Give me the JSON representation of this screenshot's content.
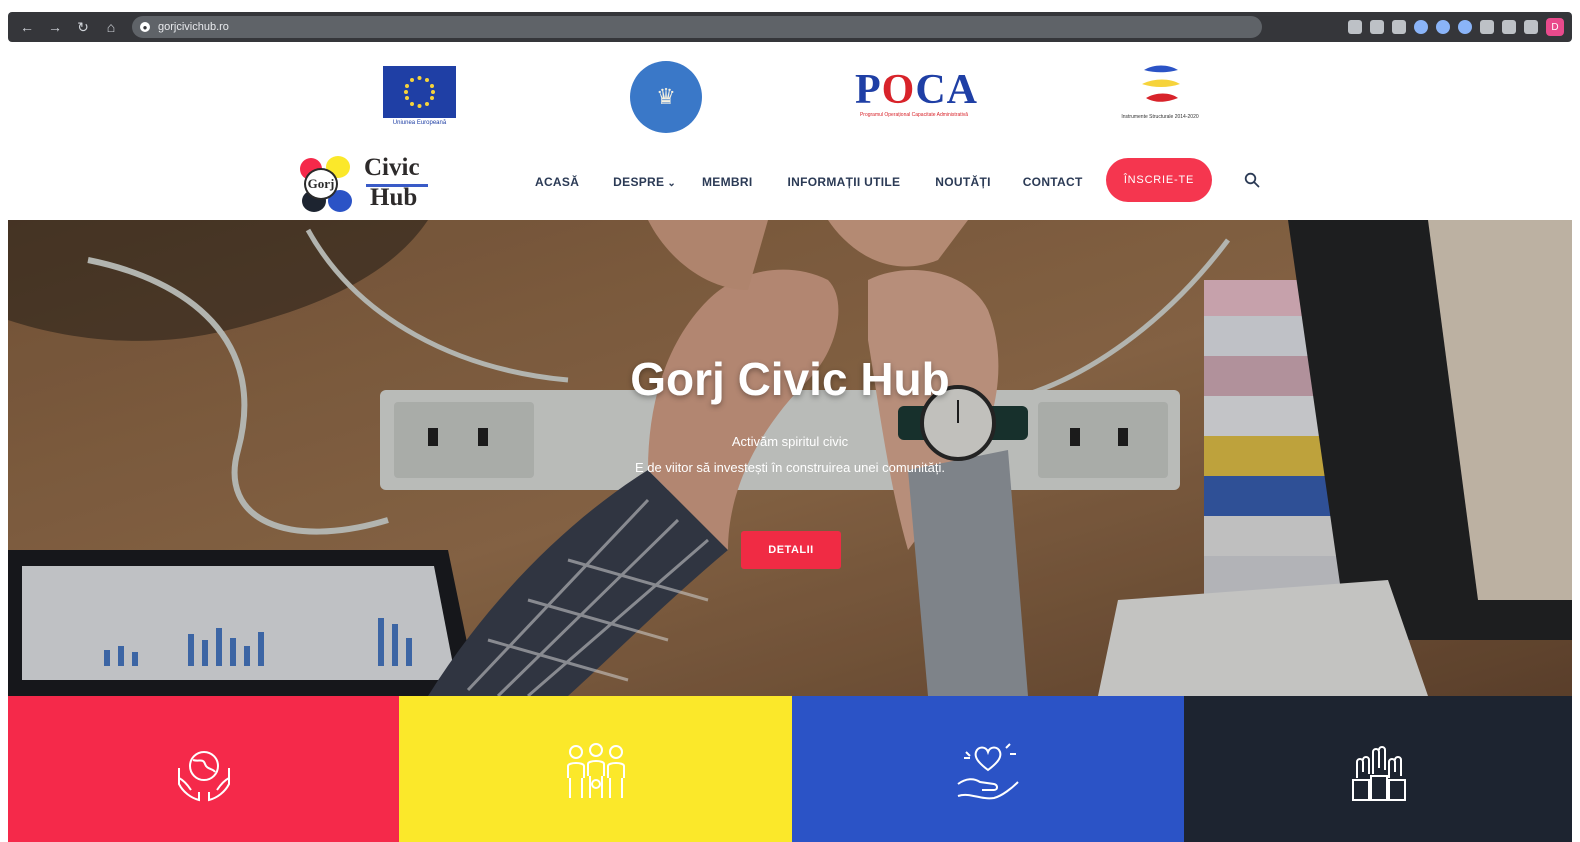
{
  "browser": {
    "url": "gorjcivichub.ro",
    "profile_initial": "D"
  },
  "logos": {
    "eu_caption": "Uniunea Europeană",
    "poca_word_1": "P",
    "poca_word_2": "O",
    "poca_word_3": "CA",
    "poca_caption": "Programul Operațional Capacitate Administrativă",
    "is_caption": "Instrumente Structurale 2014-2020"
  },
  "brand": {
    "gorj": "Gorj",
    "civic": "Civic",
    "hub": "Hub"
  },
  "nav": {
    "items": [
      {
        "label": "ACASĂ"
      },
      {
        "label": "DESPRE"
      },
      {
        "label": "MEMBRI"
      },
      {
        "label": "INFORMAȚII UTILE"
      },
      {
        "label": "NOUTĂȚI"
      },
      {
        "label": "CONTACT"
      }
    ],
    "cta": "ÎNSCRIE-TE"
  },
  "hero": {
    "title": "Gorj Civic Hub",
    "line1": "Activăm spiritul civic",
    "line2": "E de viitor să investești în construirea unei comunități.",
    "button": "DETALII"
  },
  "tiles": [
    {
      "icon": "globe-hands-icon",
      "color": "#f5294a"
    },
    {
      "icon": "people-group-icon",
      "color": "#fbe82a"
    },
    {
      "icon": "heart-hand-icon",
      "color": "#2b53c6"
    },
    {
      "icon": "raised-hands-icon",
      "color": "#1d2430"
    }
  ],
  "colors": {
    "accent": "#f5364f",
    "nav_text": "#2b3a55"
  }
}
